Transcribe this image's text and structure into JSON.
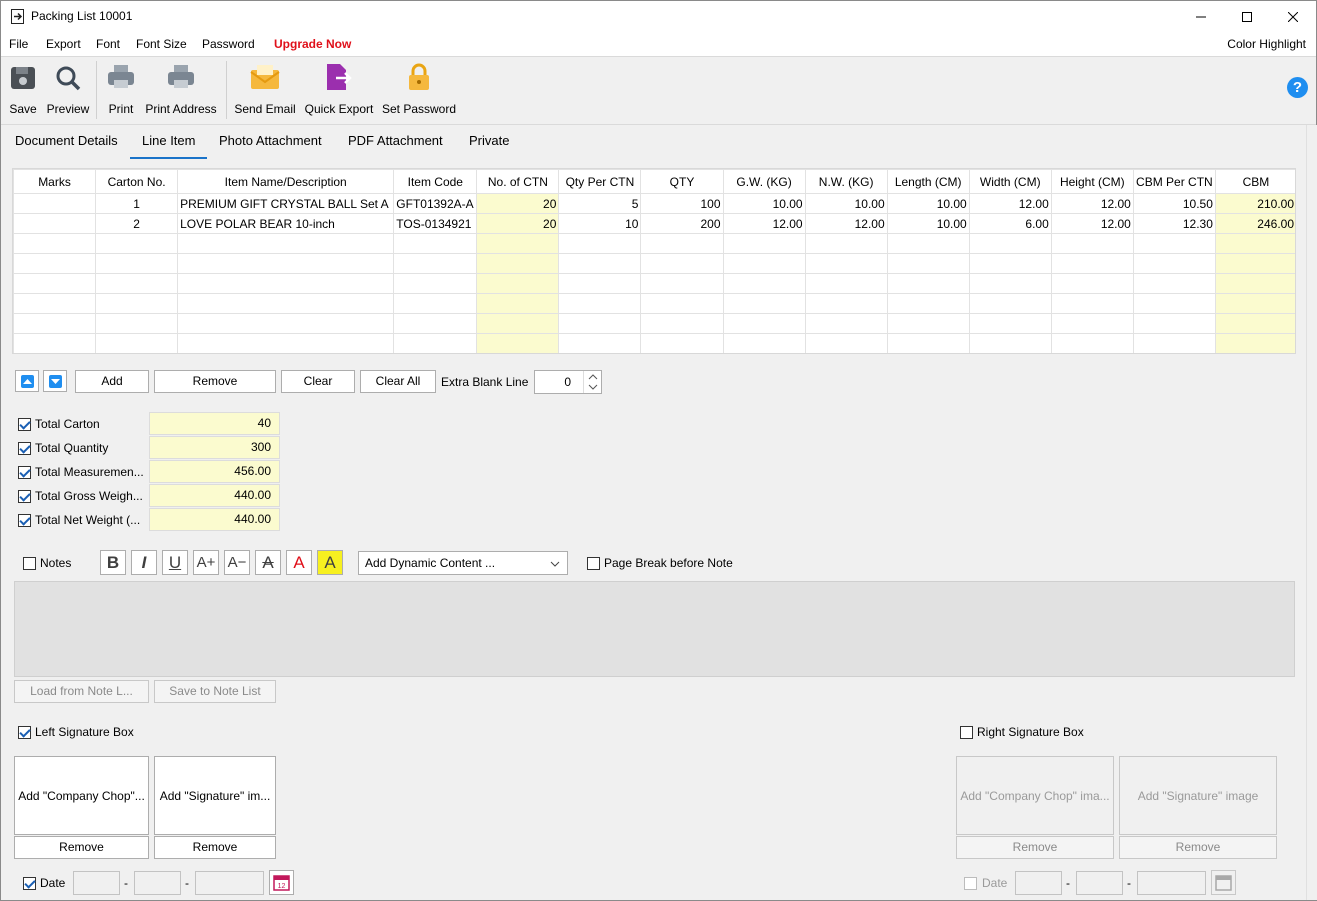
{
  "window": {
    "title": "Packing List 10001"
  },
  "menu": {
    "file": "File",
    "export": "Export",
    "font": "Font",
    "font_size": "Font Size",
    "password": "Password",
    "upgrade": "Upgrade Now",
    "color_highlight": "Color Highlight"
  },
  "toolbar": {
    "save": "Save",
    "preview": "Preview",
    "print": "Print",
    "print_address": "Print Address",
    "send_email": "Send Email",
    "quick_export": "Quick Export",
    "set_password": "Set Password"
  },
  "tabs": [
    "Document Details",
    "Line Item",
    "Photo Attachment",
    "PDF Attachment",
    "Private"
  ],
  "grid": {
    "columns": [
      "Marks",
      "Carton No.",
      "Item Name/Description",
      "Item Code",
      "No. of CTN",
      "Qty Per CTN",
      "QTY",
      "G.W. (KG)",
      "N.W. (KG)",
      "Length (CM)",
      "Width (CM)",
      "Height (CM)",
      "CBM Per CTN",
      "CBM"
    ],
    "rows": [
      [
        "",
        "1",
        "PREMIUM GIFT CRYSTAL BALL Set A",
        "GFT01392A-A",
        "20",
        "5",
        "100",
        "10.00",
        "10.00",
        "10.00",
        "12.00",
        "12.00",
        "10.50",
        "210.00"
      ],
      [
        "",
        "2",
        "LOVE POLAR BEAR 10-inch",
        "TOS-0134921",
        "20",
        "10",
        "200",
        "12.00",
        "12.00",
        "10.00",
        "6.00",
        "12.00",
        "12.30",
        "246.00"
      ]
    ]
  },
  "row_controls": {
    "add": "Add",
    "remove": "Remove",
    "clear": "Clear",
    "clear_all": "Clear All",
    "extra_blank_label": "Extra Blank Line",
    "extra_blank_value": "0"
  },
  "totals": [
    {
      "label": "Total Carton",
      "value": "40"
    },
    {
      "label": "Total Quantity",
      "value": "300"
    },
    {
      "label": "Total Measuremen...",
      "value": "456.00"
    },
    {
      "label": "Total Gross Weigh...",
      "value": "440.00"
    },
    {
      "label": "Total Net Weight (...",
      "value": "440.00"
    }
  ],
  "notes": {
    "label": "Notes",
    "dynamic": "Add Dynamic Content ...",
    "page_break": "Page Break before Note",
    "load": "Load from Note L...",
    "save": "Save to Note List"
  },
  "signature": {
    "left_label": "Left Signature Box",
    "right_label": "Right Signature Box",
    "left_chop": "Add \"Company Chop\"...",
    "left_sig": "Add \"Signature\" im...",
    "right_chop": "Add \"Company Chop\" ima...",
    "right_sig": "Add \"Signature\" image",
    "remove": "Remove",
    "date": "Date",
    "dash": "-"
  }
}
